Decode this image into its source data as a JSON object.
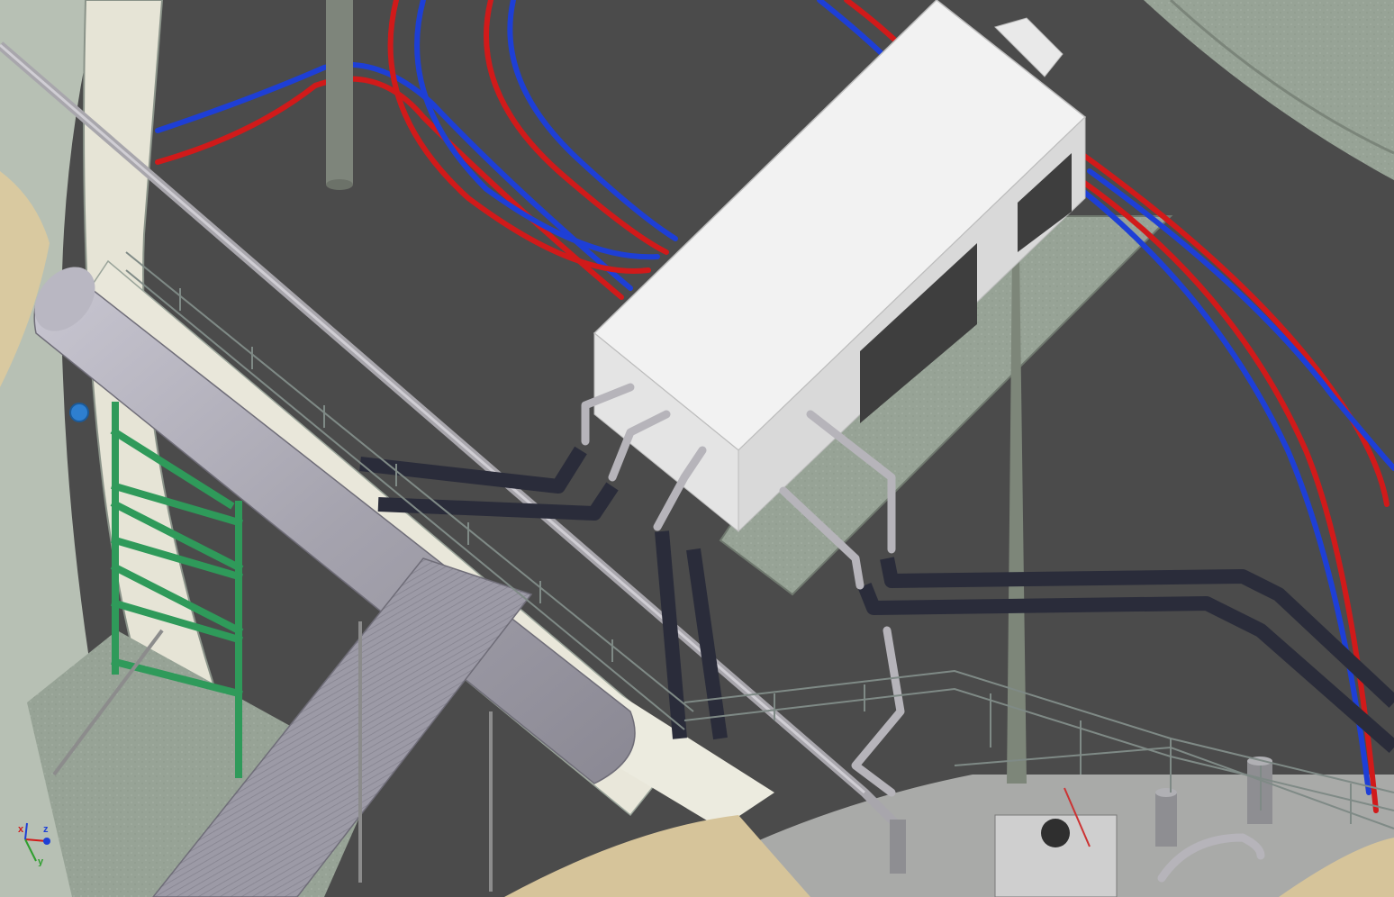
{
  "viewport": {
    "background": "#4a4a4a",
    "colors": {
      "hot_pipe": "#d11a1a",
      "cold_pipe": "#1e3fd6",
      "dark_pipe": "#2a2c3a",
      "steel_frame": "#2f9a5a",
      "concrete": "#9aa59a",
      "walkway": "#e8e6d8",
      "sand": "#d9c9a0",
      "equipment_box": "#f2f2f2"
    }
  },
  "axis_triad": {
    "x_label": "x",
    "y_label": "y",
    "z_label": "z"
  }
}
